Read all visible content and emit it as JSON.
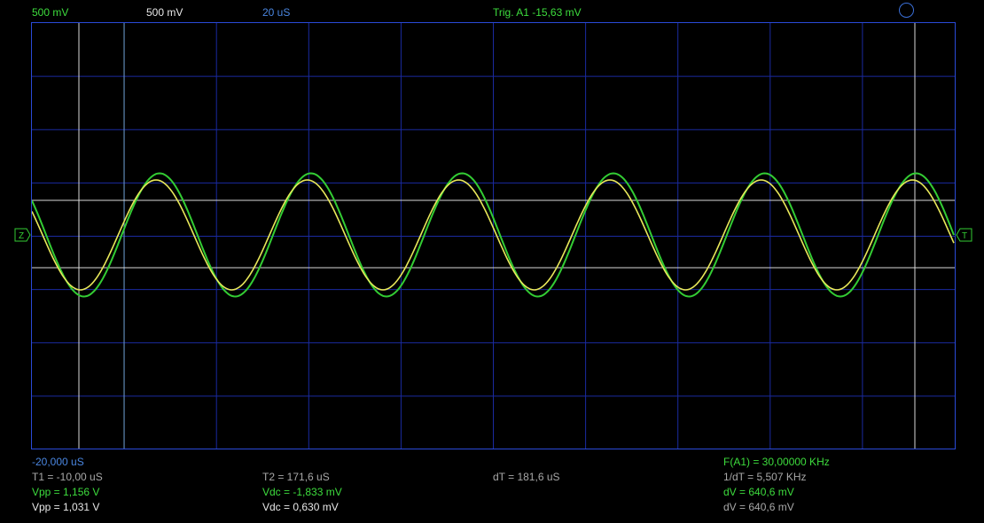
{
  "header": {
    "ch1_scale": "500 mV",
    "ch2_scale": "500 mV",
    "timebase": "20 uS",
    "trigger": "Trig. A1  -15,63 mV"
  },
  "markers": {
    "left": "Z",
    "right": "T"
  },
  "footer": {
    "start_time": "-20,000 uS",
    "t1": "T1 = -10,00 uS",
    "t2": "T2 = 171,6 uS",
    "dt": "dT = 181,6 uS",
    "freq": "F(A1) = 30,00000 KHz",
    "inv_dt": "1/dT = 5,507 KHz",
    "vpp_a": "Vpp = 1,156 V",
    "vdc_a": "Vdc = -1,833 mV",
    "dv_a": "dV = 640,6 mV",
    "vpp_b": "Vpp = 1,031 V",
    "vdc_b": "Vdc = 0,630 mV",
    "dv_b": "dV = 640,6 mV"
  },
  "colors": {
    "grid": "#1a2aa0",
    "green_trace": "#33cc33",
    "yellow_trace": "#e8e85a",
    "cursor": "#d8d8d8"
  },
  "waveform": {
    "periods_visible": 6.1,
    "green_amplitude_div": 1.156,
    "yellow_amplitude_div": 1.031
  }
}
